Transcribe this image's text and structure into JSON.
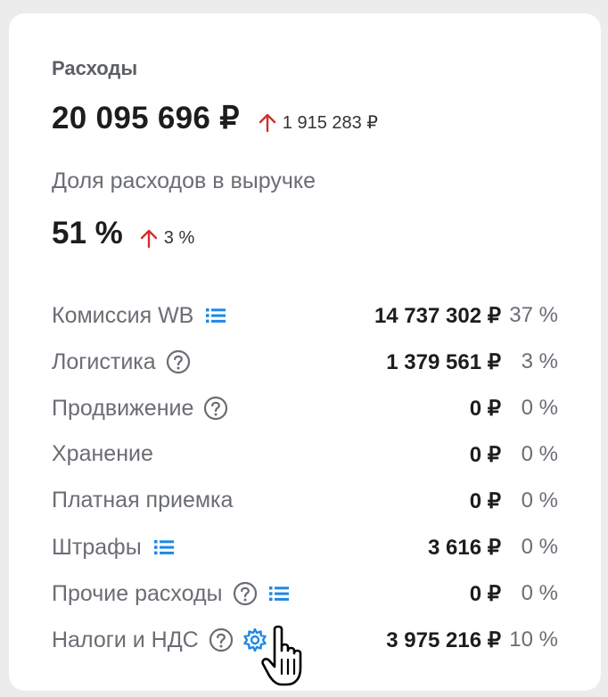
{
  "header": {
    "title": "Расходы",
    "total": "20 095 696 ₽",
    "total_change": "1 915 283 ₽",
    "total_change_direction": "up",
    "share_label": "Доля расходов в выручке",
    "share_value": "51 %",
    "share_change": "3 %",
    "share_change_direction": "up"
  },
  "colors": {
    "up_arrow": "#d32f2f",
    "icon_blue": "#1e88e5",
    "help_icon": "#6a6d73"
  },
  "rows": [
    {
      "label": "Комиссия WB",
      "amount": "14 737 302 ₽",
      "percent": "37 %",
      "icons": [
        "list-icon"
      ]
    },
    {
      "label": "Логистика",
      "amount": "1 379 561 ₽",
      "percent": "3 %",
      "icons": [
        "help-icon"
      ]
    },
    {
      "label": "Продвижение",
      "amount": "0 ₽",
      "percent": "0 %",
      "icons": [
        "help-icon"
      ]
    },
    {
      "label": "Хранение",
      "amount": "0 ₽",
      "percent": "0 %",
      "icons": []
    },
    {
      "label": "Платная приемка",
      "amount": "0 ₽",
      "percent": "0 %",
      "icons": []
    },
    {
      "label": "Штрафы",
      "amount": "3 616 ₽",
      "percent": "0 %",
      "icons": [
        "list-icon"
      ]
    },
    {
      "label": "Прочие расходы",
      "amount": "0 ₽",
      "percent": "0 %",
      "icons": [
        "help-icon",
        "list-icon"
      ]
    },
    {
      "label": "Налоги и НДС",
      "amount": "3 975 216 ₽",
      "percent": "10 %",
      "icons": [
        "help-icon",
        "gear-icon"
      ]
    }
  ]
}
